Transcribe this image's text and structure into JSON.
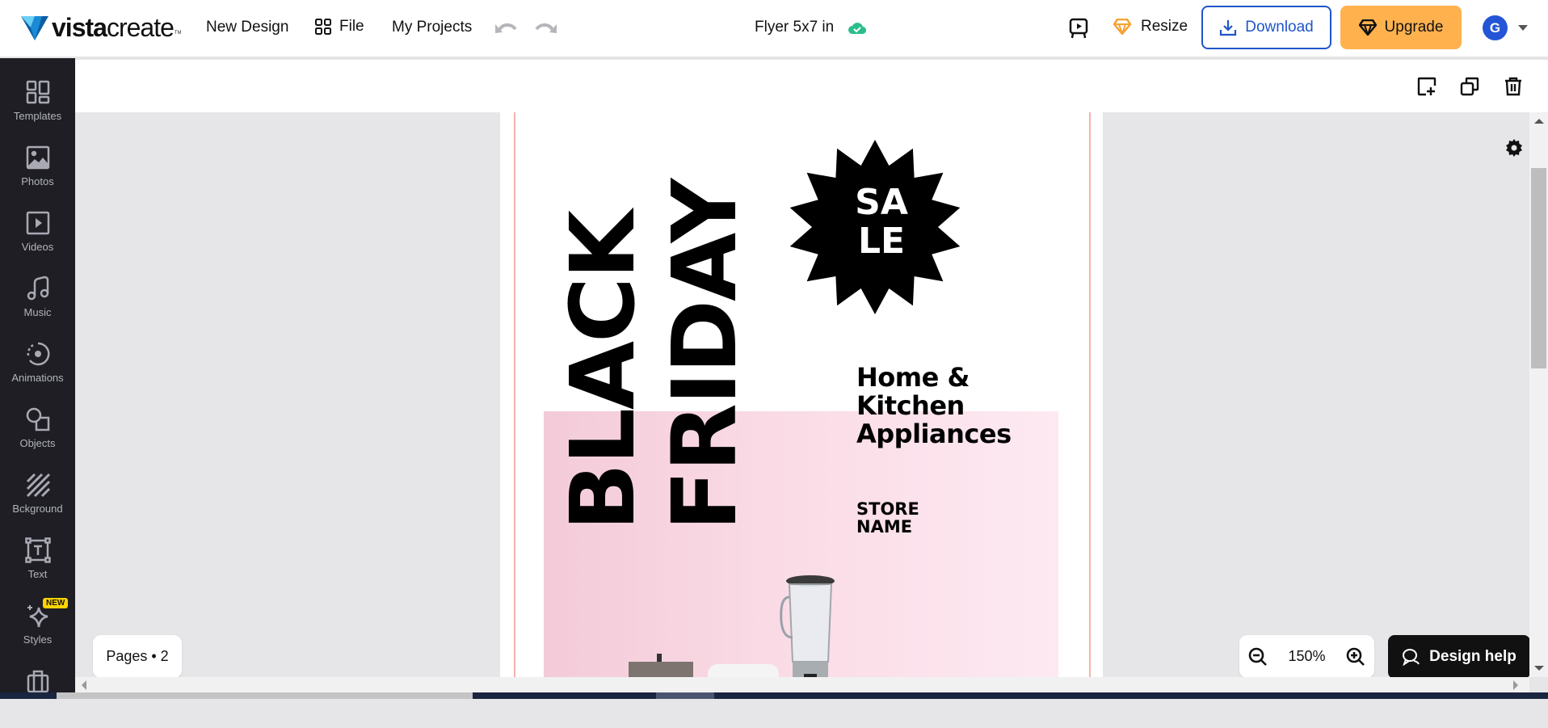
{
  "header": {
    "brand": {
      "bold": "vista",
      "regular": "create",
      "tm": "TM"
    },
    "nav": [
      {
        "label": "New Design"
      },
      {
        "label": "File",
        "icon": "grid-icon"
      },
      {
        "label": "My Projects"
      }
    ],
    "undo_icon": "undo-icon",
    "redo_icon": "redo-icon",
    "document_title": "Flyer 5x7 in",
    "save_status_icon": "cloud-check-icon",
    "present_icon": "presentation-play-icon",
    "resize_label": "Resize",
    "download_label": "Download",
    "upgrade_label": "Upgrade",
    "avatar_initial": "G",
    "colors": {
      "brand_blue": "#1f55c9",
      "upgrade_orange": "#ffb14e",
      "resize_diamond": "#f7a233",
      "saved_green": "#2bbd8c"
    }
  },
  "sidebar": {
    "items": [
      {
        "label": "Templates",
        "icon": "templates-icon"
      },
      {
        "label": "Photos",
        "icon": "photo-icon"
      },
      {
        "label": "Videos",
        "icon": "video-icon"
      },
      {
        "label": "Music",
        "icon": "music-note-icon"
      },
      {
        "label": "Animations",
        "icon": "animation-icon"
      },
      {
        "label": "Objects",
        "icon": "shapes-icon"
      },
      {
        "label": "Bckground",
        "icon": "background-stripes-icon"
      },
      {
        "label": "Text",
        "icon": "text-box-icon"
      },
      {
        "label": "Styles",
        "icon": "sparkle-icon",
        "badge": "NEW"
      },
      {
        "label": "",
        "icon": "briefcase-icon"
      }
    ]
  },
  "toolbar": {
    "add_page_icon": "add-page-icon",
    "duplicate_icon": "duplicate-icon",
    "delete_icon": "trash-icon",
    "settings_icon": "gear-icon"
  },
  "canvas": {
    "black": "BLACK",
    "friday": "FRIDAY",
    "sale_line1": "SA",
    "sale_line2": "LE",
    "headline": [
      "Home &",
      "Kitchen",
      "Appliances"
    ],
    "store": [
      "STORE",
      "NAME"
    ]
  },
  "footer": {
    "pages_label": "Pages • 2",
    "zoom_value": "150%",
    "design_help_label": "Design help"
  }
}
